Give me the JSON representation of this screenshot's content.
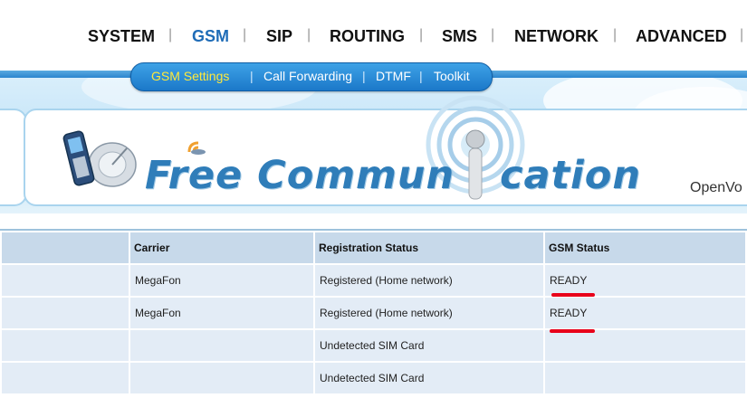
{
  "nav": {
    "items": [
      {
        "label": "SYSTEM",
        "active": false
      },
      {
        "label": "GSM",
        "active": true
      },
      {
        "label": "SIP",
        "active": false
      },
      {
        "label": "ROUTING",
        "active": false
      },
      {
        "label": "SMS",
        "active": false
      },
      {
        "label": "NETWORK",
        "active": false
      },
      {
        "label": "ADVANCED",
        "active": false
      }
    ],
    "separator": "|"
  },
  "submenu": {
    "items": [
      {
        "label": "GSM Settings",
        "active": true
      },
      {
        "label": "Call Forwarding",
        "active": false
      },
      {
        "label": "DTMF",
        "active": false
      },
      {
        "label": "Toolkit",
        "active": false
      }
    ],
    "separator": "|"
  },
  "banner": {
    "slogan_left": "Free Commun",
    "slogan_right": "cation",
    "brand_partial": "OpenVo"
  },
  "table": {
    "headers": [
      "",
      "Carrier",
      "Registration Status",
      "GSM Status"
    ],
    "rows": [
      [
        "",
        "MegaFon",
        "Registered (Home network)",
        "READY"
      ],
      [
        "",
        "MegaFon",
        "Registered (Home network)",
        "READY"
      ],
      [
        "",
        "",
        "Undetected SIM Card",
        ""
      ],
      [
        "",
        "",
        "Undetected SIM Card",
        ""
      ]
    ]
  },
  "colors": {
    "nav_active": "#1f6cb7",
    "submenu_active": "#ffe93b",
    "annotation": "#e8001a"
  }
}
